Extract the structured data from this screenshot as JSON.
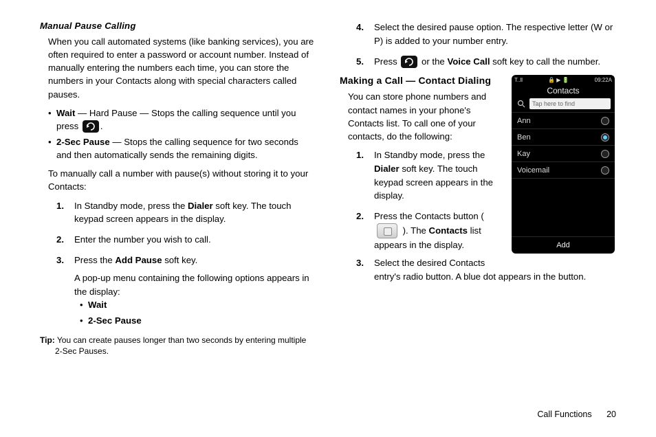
{
  "left": {
    "heading": "Manual Pause Calling",
    "intro": "When you call automated systems (like banking services), you are often required to enter a password or account number. Instead of manually entering the numbers each time, you can store the numbers in your Contacts along with special characters called pauses.",
    "pauses": [
      {
        "name": "Wait",
        "desc_before": " — Hard Pause — Stops the calling sequence until you press ",
        "desc_after": "."
      },
      {
        "name": "2-Sec Pause",
        "desc": " — Stops the calling sequence for two seconds and then automatically sends the remaining digits."
      }
    ],
    "lead": "To manually call a number with pause(s) without storing it to your Contacts:",
    "steps": [
      {
        "n": "1.",
        "pre": "In Standby mode, press the ",
        "bold": "Dialer",
        "post": " soft key. The touch keypad screen appears in the display."
      },
      {
        "n": "2.",
        "text": "Enter the number you wish to call."
      },
      {
        "n": "3.",
        "pre": "Press the ",
        "bold": "Add Pause",
        "post": " soft key.",
        "sub": "A pop-up menu containing the following options appears in the display:",
        "opts": [
          "Wait",
          "2-Sec Pause"
        ]
      }
    ],
    "tip_label": "Tip:",
    "tip": " You can create pauses longer than two seconds by entering multiple 2-Sec Pauses."
  },
  "right": {
    "cont": [
      {
        "n": "4.",
        "text": "Select the desired pause option. The respective letter (W or P) is added to your number entry."
      },
      {
        "n": "5.",
        "pre": "Press ",
        "mid": " or the ",
        "bold": "Voice Call",
        "post": " soft key to call the number."
      }
    ],
    "heading": "Making a Call — Contact Dialing",
    "intro": "You can store phone numbers and contact names in your phone's Contacts list. To call one of your contacts, do the following:",
    "steps": [
      {
        "n": "1.",
        "pre": "In Standby mode, press the ",
        "bold": "Dialer",
        "post": " soft key. The touch keypad screen appears in the display."
      },
      {
        "n": "2.",
        "pre": "Press the Contacts button ( ",
        "post": " ). The ",
        "bold": "Contacts",
        "tail": " list appears in the display."
      },
      {
        "n": "3.",
        "text": "Select the desired Contacts entry's radio button. A blue dot appears in the button."
      }
    ]
  },
  "phone": {
    "status_left": "T..ll",
    "status_right": "09:22A",
    "title": "Contacts",
    "search_placeholder": "Tap here to find",
    "rows": [
      {
        "name": "Ann",
        "selected": false
      },
      {
        "name": "Ben",
        "selected": true
      },
      {
        "name": "Kay",
        "selected": false
      },
      {
        "name": "Voicemail",
        "selected": false
      }
    ],
    "bottom": "Add"
  },
  "footer": {
    "section": "Call Functions",
    "page": "20"
  }
}
